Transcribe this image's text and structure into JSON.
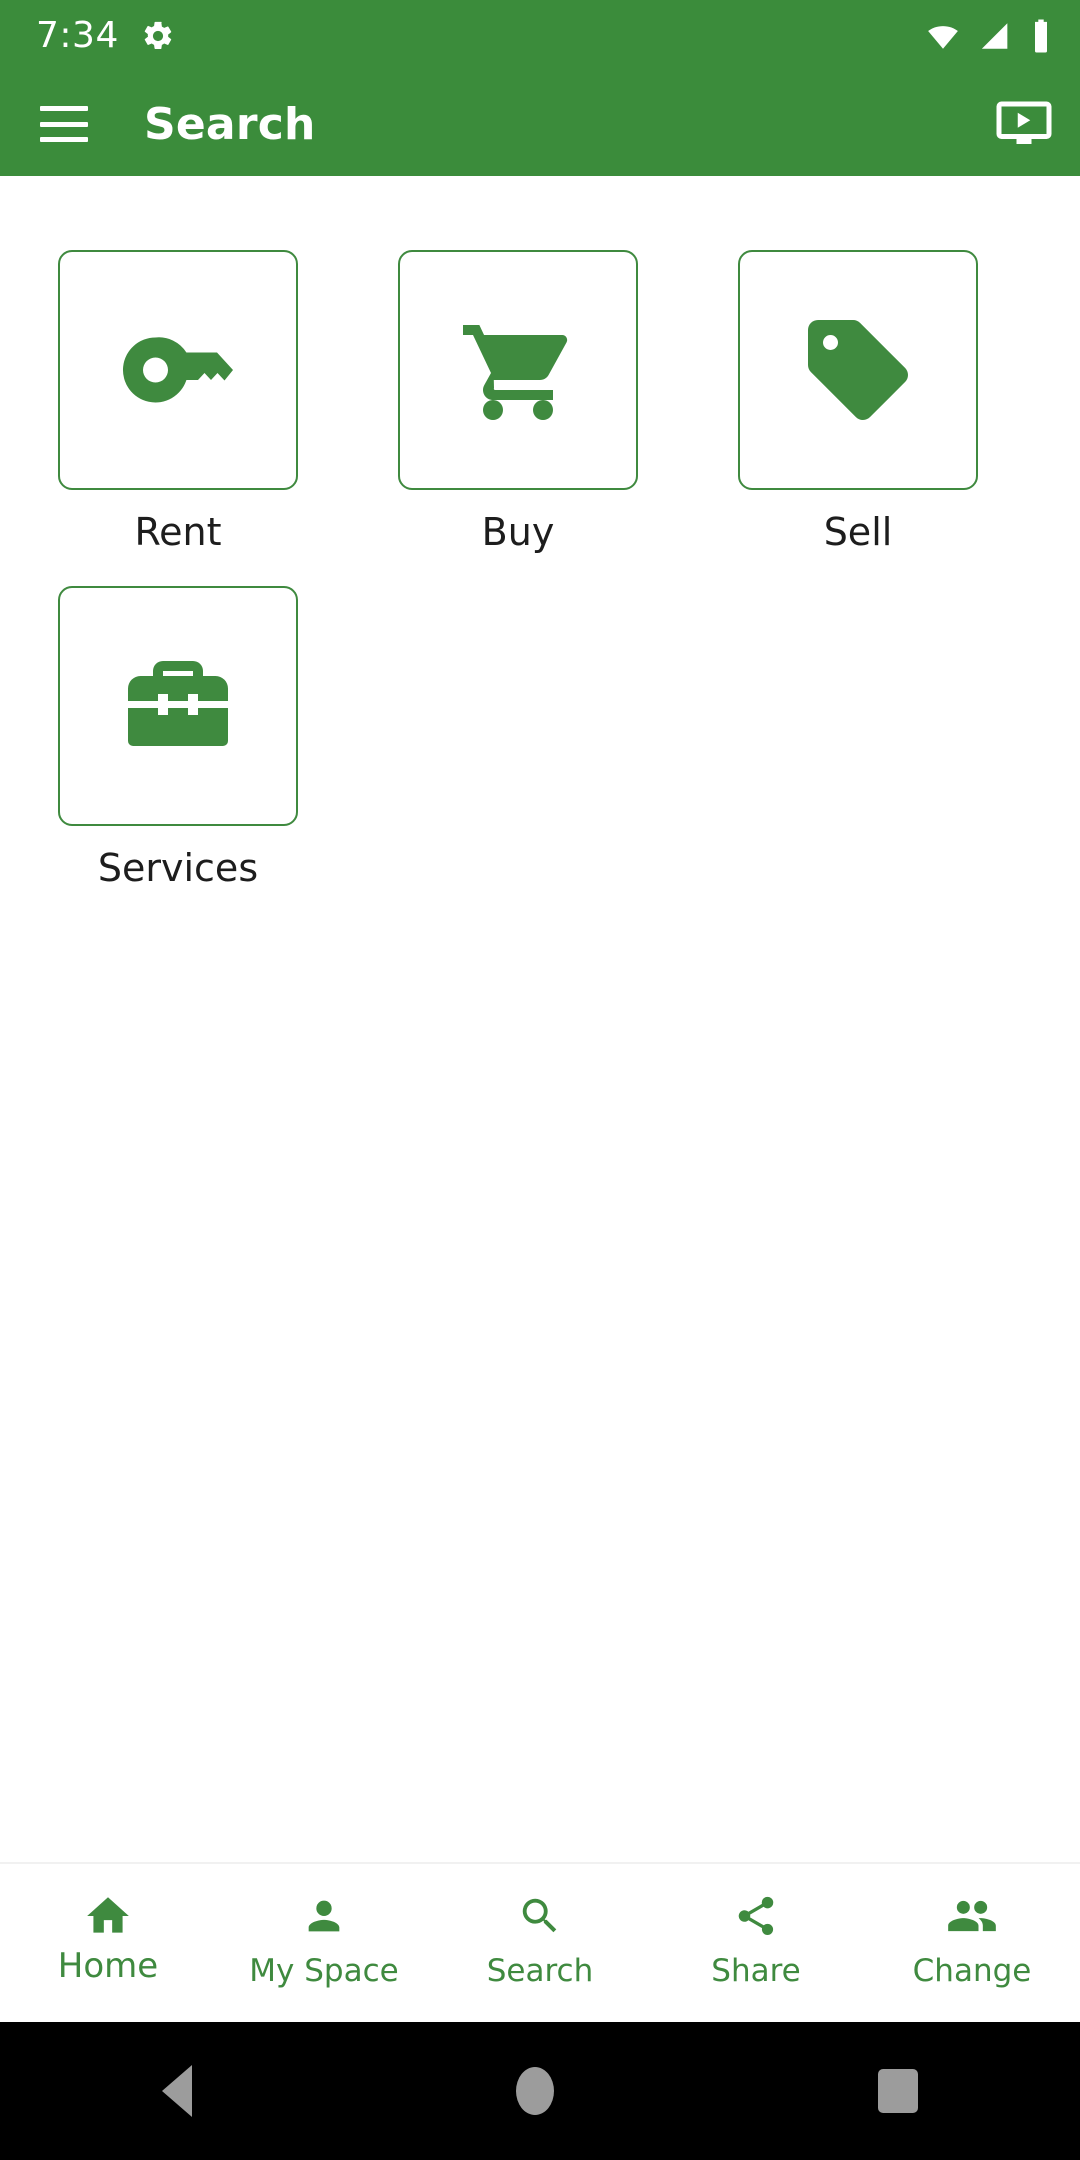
{
  "status_bar": {
    "time": "7:34",
    "icons": [
      "settings-gear-icon",
      "wifi-icon",
      "cell-signal-icon",
      "battery-icon"
    ]
  },
  "app_bar": {
    "menu_icon": "hamburger-menu-icon",
    "title": "Search",
    "action_icon": "ondemand-video-icon"
  },
  "colors": {
    "primary_green": "#3b8c3b",
    "accent_green": "#3f8a3f",
    "tile_border": "#3f8a3f",
    "label_text": "#1d1d1d",
    "nav_background": "#ffffff",
    "system_nav": "#000000",
    "system_nav_icon": "#9c9c9c"
  },
  "main": {
    "tiles": [
      {
        "label": "Rent",
        "icon": "key-icon"
      },
      {
        "label": "Buy",
        "icon": "shopping-cart-icon"
      },
      {
        "label": "Sell",
        "icon": "price-tag-icon"
      },
      {
        "label": "Services",
        "icon": "toolbox-icon"
      }
    ]
  },
  "bottom_nav": {
    "items": [
      {
        "label": "Home",
        "icon": "home-icon",
        "active": true
      },
      {
        "label": "My Space",
        "icon": "person-icon",
        "active": false
      },
      {
        "label": "Search",
        "icon": "search-icon",
        "active": false
      },
      {
        "label": "Share",
        "icon": "share-icon",
        "active": false
      },
      {
        "label": "Change",
        "icon": "people-icon",
        "active": false
      }
    ]
  },
  "system_nav": {
    "back": "back-triangle-icon",
    "home": "home-circle-icon",
    "recents": "recents-square-icon"
  }
}
